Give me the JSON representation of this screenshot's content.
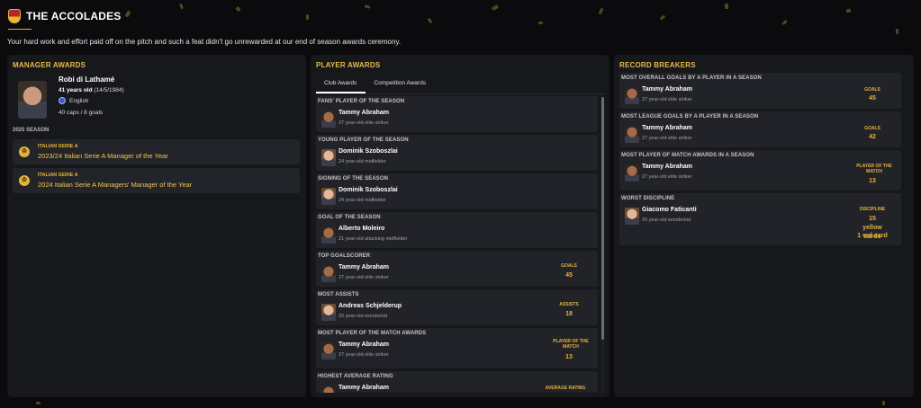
{
  "header": {
    "title": "THE ACCOLADES",
    "subtitle": "Your hard work and effort paid off on the pitch and such a feat didn't go unrewarded at our end of season awards ceremony."
  },
  "manager": {
    "panel_title": "MANAGER AWARDS",
    "name": "Robi di Lathamé",
    "age_bold": "41 years old",
    "dob": "(14/5/1984)",
    "nationality": "English",
    "caps": "40 caps / 8 goals",
    "season_label": "2025 SEASON",
    "trophies": [
      {
        "competition": "ITALIAN SERIE A",
        "name": "2023/24 Italian Serie A Manager of the Year"
      },
      {
        "competition": "ITALIAN SERIE A",
        "name": "2024 Italian Serie A Managers' Manager of the Year"
      }
    ]
  },
  "player": {
    "panel_title": "PLAYER AWARDS",
    "tabs": [
      "Club Awards",
      "Competition Awards"
    ],
    "awards": [
      {
        "heading": "FANS' PLAYER OF THE SEASON",
        "name": "Tammy Abraham",
        "desc": "27 year-old elite striker",
        "stat_label": "",
        "stat_value": ""
      },
      {
        "heading": "YOUNG PLAYER OF THE SEASON",
        "name": "Dominik Szoboszlai",
        "desc": "24 year-old midfielder",
        "stat_label": "",
        "stat_value": ""
      },
      {
        "heading": "SIGNING OF THE SEASON",
        "name": "Dominik Szoboszlai",
        "desc": "24 year-old midfielder",
        "stat_label": "",
        "stat_value": ""
      },
      {
        "heading": "GOAL OF THE SEASON",
        "name": "Alberto Moleiro",
        "desc": "21 year-old attacking midfielder",
        "stat_label": "",
        "stat_value": ""
      },
      {
        "heading": "TOP GOALSCORER",
        "name": "Tammy Abraham",
        "desc": "27 year-old elite striker",
        "stat_label": "GOALS",
        "stat_value": "45"
      },
      {
        "heading": "MOST ASSISTS",
        "name": "Andreas Schjelderup",
        "desc": "20 year-old wonderkid",
        "stat_label": "ASSISTS",
        "stat_value": "18"
      },
      {
        "heading": "MOST PLAYER OF THE MATCH AWARDS",
        "name": "Tammy Abraham",
        "desc": "27 year-old elite striker",
        "stat_label": "PLAYER OF THE MATCH",
        "stat_value": "13"
      },
      {
        "heading": "HIGHEST AVERAGE RATING",
        "name": "Tammy Abraham",
        "desc": "",
        "stat_label": "AVERAGE RATING",
        "stat_value": ""
      }
    ]
  },
  "records": {
    "panel_title": "RECORD BREAKERS",
    "items": [
      {
        "heading": "MOST OVERALL GOALS BY A PLAYER IN A SEASON",
        "name": "Tammy Abraham",
        "desc": "27 year-old elite striker",
        "stat_label": "GOALS",
        "stat_value": "45"
      },
      {
        "heading": "MOST LEAGUE GOALS BY A PLAYER IN A SEASON",
        "name": "Tammy Abraham",
        "desc": "27 year-old elite striker",
        "stat_label": "GOALS",
        "stat_value": "42"
      },
      {
        "heading": "MOST PLAYER OF MATCH AWARDS IN A SEASON",
        "name": "Tammy Abraham",
        "desc": "27 year-old elite striker",
        "stat_label": "PLAYER OF THE MATCH",
        "stat_value": "13"
      },
      {
        "heading": "WORST DISCIPLINE",
        "name": "Giacomo Faticanti",
        "desc": "20 year-old wonderkid",
        "stat_label": "DISCIPLINE",
        "stat_value": "15 yellow cards",
        "stat_value_2": "1 red card"
      }
    ]
  },
  "colors": {
    "accent": "#e6b33a",
    "panel": "#17181c",
    "card": "#222328"
  }
}
